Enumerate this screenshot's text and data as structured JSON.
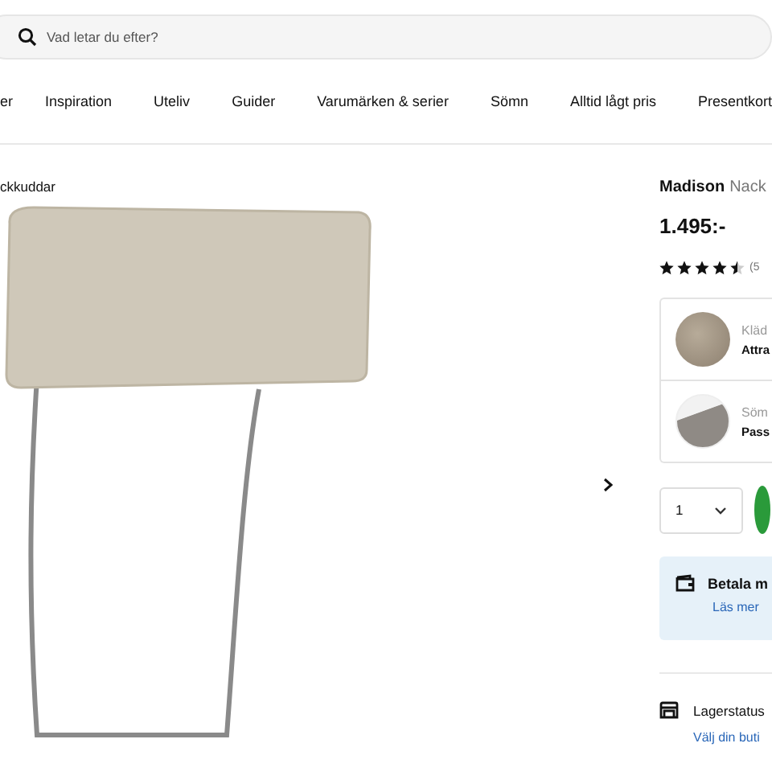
{
  "search": {
    "placeholder": "Vad letar du efter?"
  },
  "nav": [
    "er",
    "Inspiration",
    "Uteliv",
    "Guider",
    "Varumärken & serier",
    "Sömn",
    "Alltid lågt pris",
    "Presentkort"
  ],
  "breadcrumb": "ckkuddar",
  "product": {
    "brand": "Madison",
    "name": "Nack",
    "price": "1.495:-",
    "stars": 4.5,
    "review_count": "(5"
  },
  "options": [
    {
      "label": "Kläd",
      "value": "Attra",
      "kind": "fabric"
    },
    {
      "label": "Söm",
      "value": "Pass",
      "kind": "seam"
    }
  ],
  "quantity": "1",
  "payment": {
    "title": "Betala m",
    "link": "Läs mer"
  },
  "stock": {
    "title": "Lagerstatus",
    "link": "Välj din buti"
  }
}
